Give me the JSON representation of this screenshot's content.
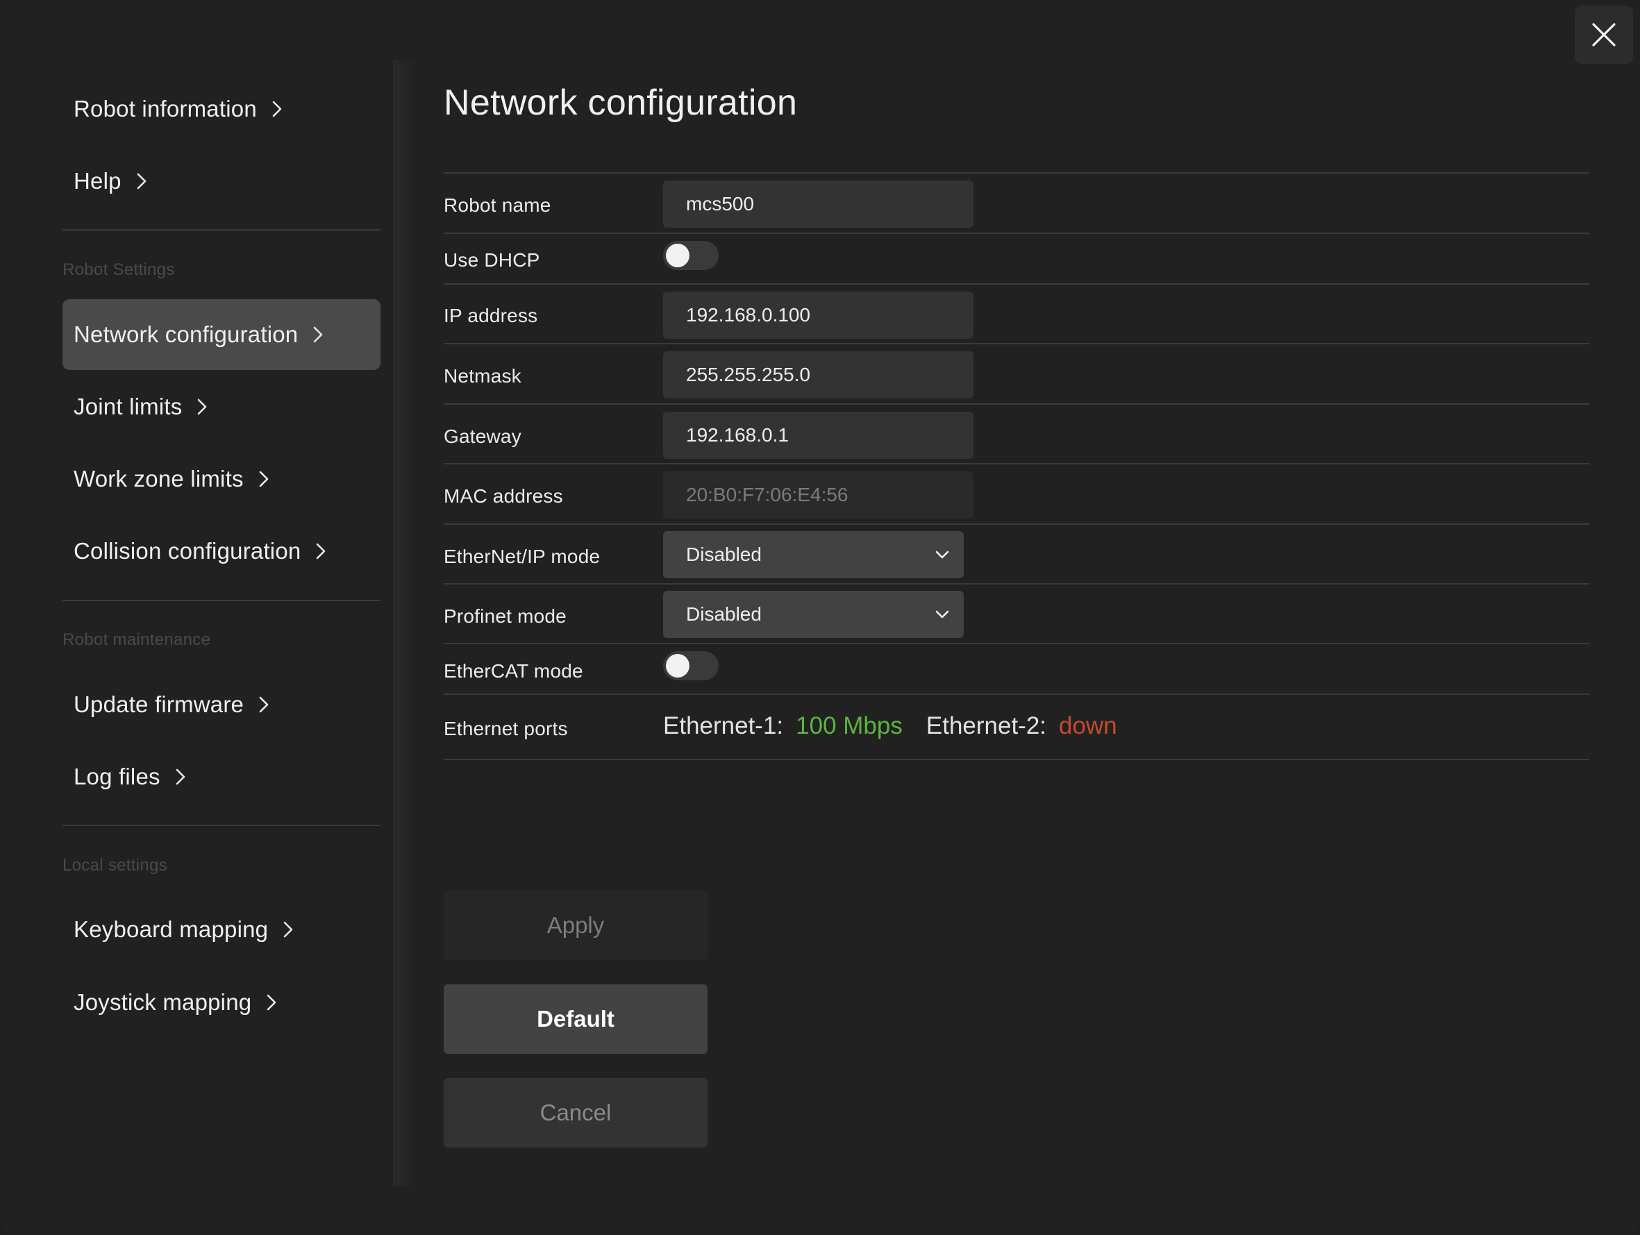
{
  "sidebar": {
    "top_items": [
      {
        "label": "Robot information"
      },
      {
        "label": "Help"
      }
    ],
    "sections": [
      {
        "title": "Robot Settings",
        "items": [
          {
            "label": "Network configuration",
            "active": true
          },
          {
            "label": "Joint limits"
          },
          {
            "label": "Work zone limits"
          },
          {
            "label": "Collision configuration"
          }
        ]
      },
      {
        "title": "Robot maintenance",
        "items": [
          {
            "label": "Update firmware"
          },
          {
            "label": "Log files"
          }
        ]
      },
      {
        "title": "Local settings",
        "items": [
          {
            "label": "Keyboard mapping"
          },
          {
            "label": "Joystick mapping"
          }
        ]
      }
    ]
  },
  "main": {
    "title": "Network configuration",
    "robot_name": {
      "label": "Robot name",
      "value": "mcs500"
    },
    "use_dhcp": {
      "label": "Use DHCP",
      "enabled": false
    },
    "ip_address": {
      "label": "IP address",
      "value": "192.168.0.100"
    },
    "netmask": {
      "label": "Netmask",
      "value": "255.255.255.0"
    },
    "gateway": {
      "label": "Gateway",
      "value": "192.168.0.1"
    },
    "mac_address": {
      "label": "MAC address",
      "value": "20:B0:F7:06:E4:56"
    },
    "ethernet_ip_mode": {
      "label": "EtherNet/IP mode",
      "value": "Disabled"
    },
    "profinet_mode": {
      "label": "Profinet mode",
      "value": "Disabled"
    },
    "ethercat_mode": {
      "label": "EtherCAT mode",
      "enabled": false
    },
    "ethernet_ports": {
      "label": "Ethernet ports",
      "port1_name": "Ethernet-1:",
      "port1_status": "100 Mbps",
      "port2_name": "Ethernet-2:",
      "port2_status": "down"
    },
    "buttons": {
      "apply": "Apply",
      "default": "Default",
      "cancel": "Cancel"
    }
  },
  "colors": {
    "status_up": "#5cb53f",
    "status_down": "#c84a2c",
    "active_nav": "#4a4a4a"
  },
  "icons": {
    "close": "close-icon",
    "chevron_right": "chevron-right-icon",
    "chevron_down": "chevron-down-icon"
  }
}
